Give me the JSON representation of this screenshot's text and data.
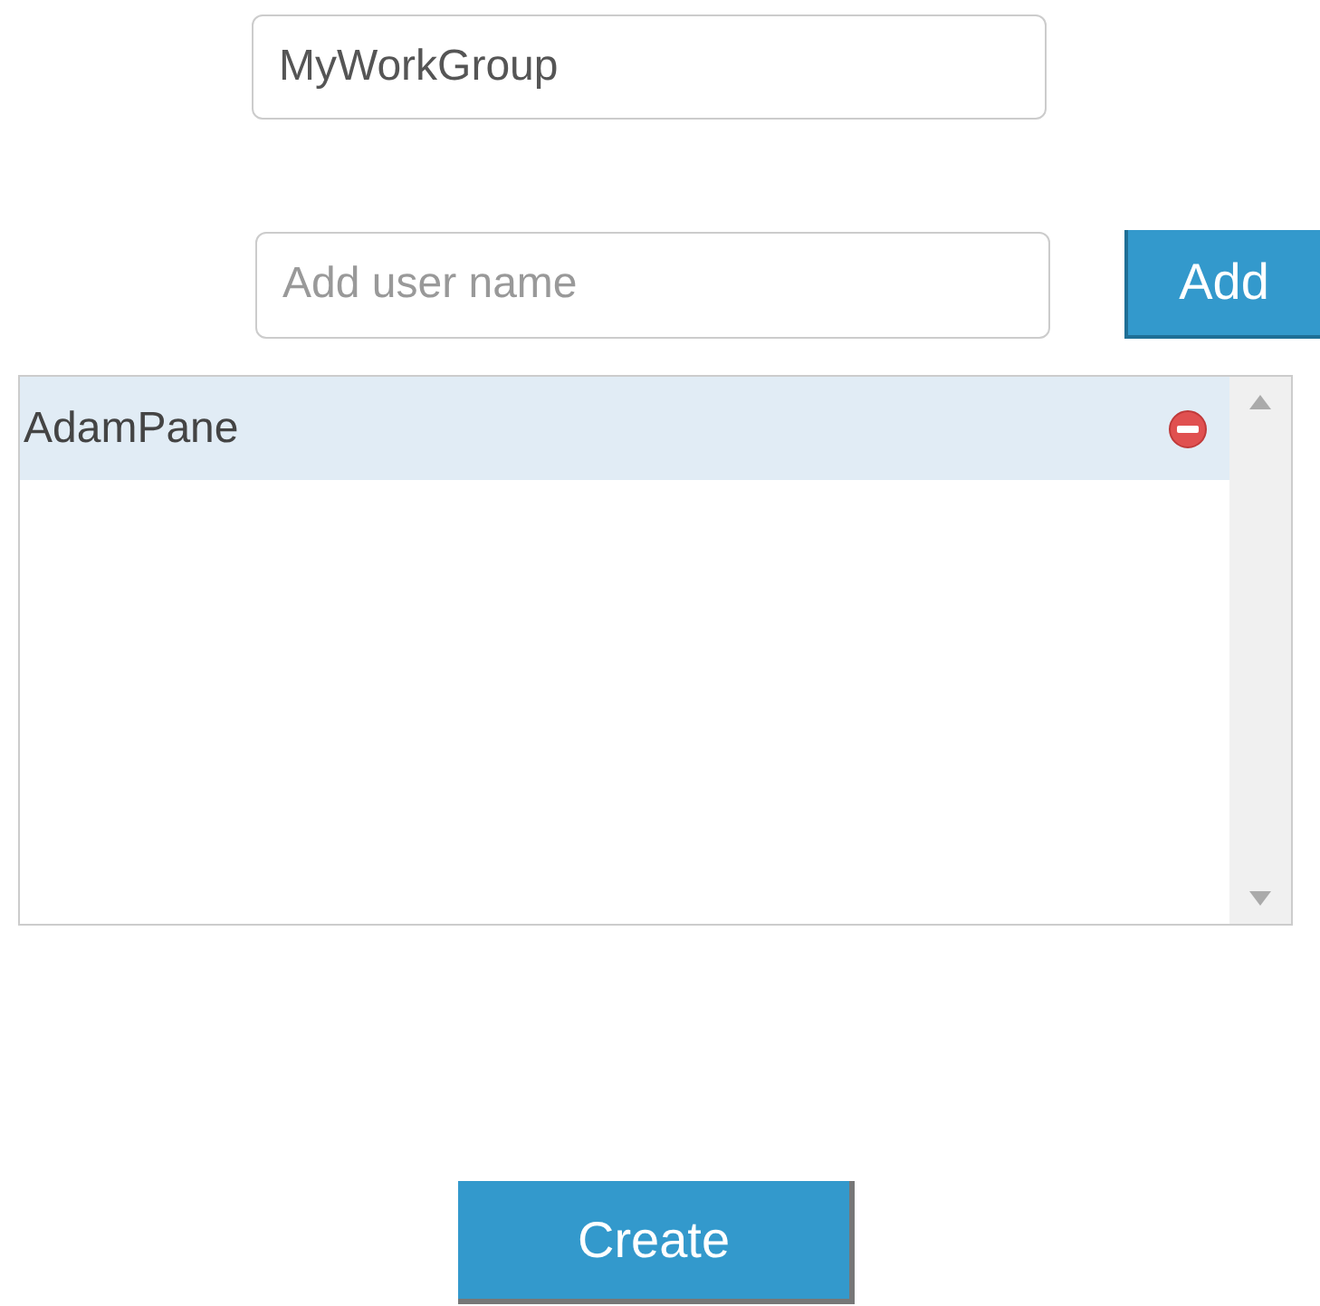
{
  "group_name": {
    "value": "MyWorkGroup"
  },
  "user_field": {
    "placeholder": "Add user name"
  },
  "add_button": {
    "label": "Add"
  },
  "users": [
    {
      "name": "AdamPane",
      "selected": true
    }
  ],
  "create_button": {
    "label": "Create"
  }
}
